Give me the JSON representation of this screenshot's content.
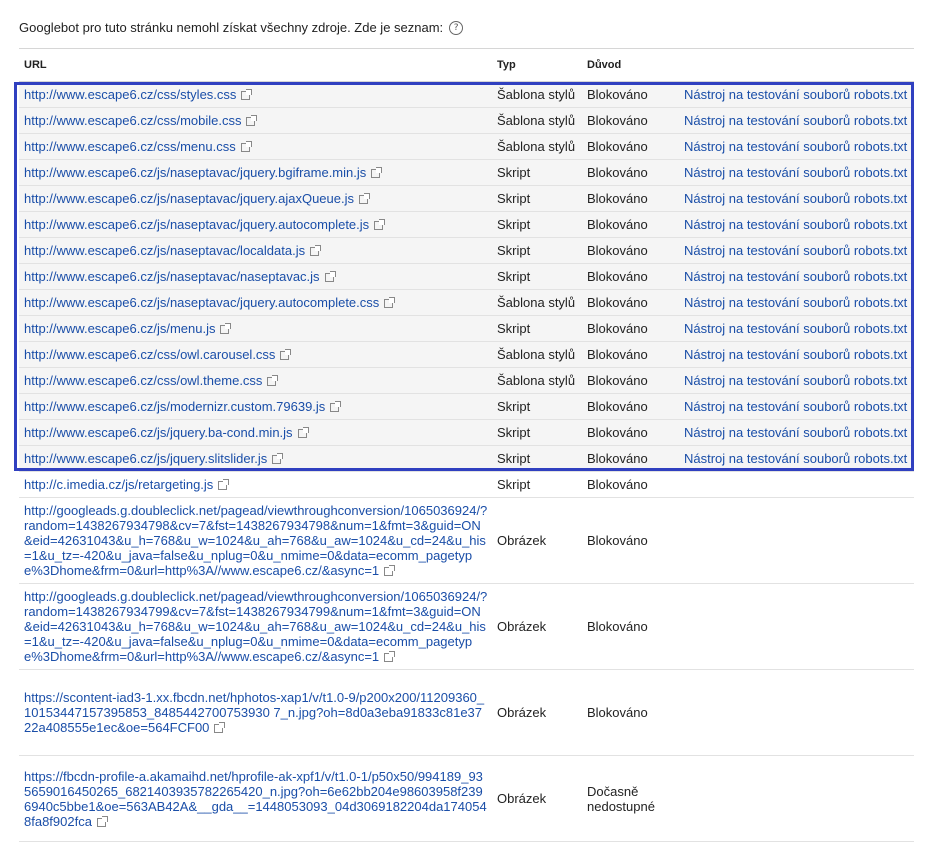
{
  "intro_text": "Googlebot pro tuto stránku nemohl získat všechny zdroje. Zde je seznam:",
  "help_icon": "question-circle-icon",
  "columns": {
    "url": "URL",
    "type": "Typ",
    "reason": "Důvod"
  },
  "highlight_color": "#3040c0",
  "link_color": "#1a4ea8",
  "rows": [
    {
      "url": "http://www.escape6.cz/css/styles.css",
      "type": "Šablona stylů",
      "reason": "Blokováno",
      "tool": "Nástroj na testování souborů robots.txt"
    },
    {
      "url": "http://www.escape6.cz/css/mobile.css",
      "type": "Šablona stylů",
      "reason": "Blokováno",
      "tool": "Nástroj na testování souborů robots.txt"
    },
    {
      "url": "http://www.escape6.cz/css/menu.css",
      "type": "Šablona stylů",
      "reason": "Blokováno",
      "tool": "Nástroj na testování souborů robots.txt"
    },
    {
      "url": "http://www.escape6.cz/js/naseptavac/jquery.bgiframe.min.js",
      "type": "Skript",
      "reason": "Blokováno",
      "tool": "Nástroj na testování souborů robots.txt"
    },
    {
      "url": "http://www.escape6.cz/js/naseptavac/jquery.ajaxQueue.js",
      "type": "Skript",
      "reason": "Blokováno",
      "tool": "Nástroj na testování souborů robots.txt"
    },
    {
      "url": "http://www.escape6.cz/js/naseptavac/jquery.autocomplete.js",
      "type": "Skript",
      "reason": "Blokováno",
      "tool": "Nástroj na testování souborů robots.txt"
    },
    {
      "url": "http://www.escape6.cz/js/naseptavac/localdata.js",
      "type": "Skript",
      "reason": "Blokováno",
      "tool": "Nástroj na testování souborů robots.txt"
    },
    {
      "url": "http://www.escape6.cz/js/naseptavac/naseptavac.js",
      "type": "Skript",
      "reason": "Blokováno",
      "tool": "Nástroj na testování souborů robots.txt"
    },
    {
      "url": "http://www.escape6.cz/js/naseptavac/jquery.autocomplete.css",
      "type": "Šablona stylů",
      "reason": "Blokováno",
      "tool": "Nástroj na testování souborů robots.txt"
    },
    {
      "url": "http://www.escape6.cz/js/menu.js",
      "type": "Skript",
      "reason": "Blokováno",
      "tool": "Nástroj na testování souborů robots.txt"
    },
    {
      "url": "http://www.escape6.cz/css/owl.carousel.css",
      "type": "Šablona stylů",
      "reason": "Blokováno",
      "tool": "Nástroj na testování souborů robots.txt"
    },
    {
      "url": "http://www.escape6.cz/css/owl.theme.css",
      "type": "Šablona stylů",
      "reason": "Blokováno",
      "tool": "Nástroj na testování souborů robots.txt"
    },
    {
      "url": "http://www.escape6.cz/js/modernizr.custom.79639.js",
      "type": "Skript",
      "reason": "Blokováno",
      "tool": "Nástroj na testování souborů robots.txt"
    },
    {
      "url": "http://www.escape6.cz/js/jquery.ba-cond.min.js",
      "type": "Skript",
      "reason": "Blokováno",
      "tool": "Nástroj na testování souborů robots.txt"
    },
    {
      "url": "http://www.escape6.cz/js/jquery.slitslider.js",
      "type": "Skript",
      "reason": "Blokováno",
      "tool": "Nástroj na testování souborů robots.txt"
    },
    {
      "url": "http://c.imedia.cz/js/retargeting.js",
      "type": "Skript",
      "reason": "Blokováno",
      "tool": ""
    },
    {
      "url": "http://googleads.g.doubleclick.net/pagead/viewthroughconversion/1065036924/?random=1438267934798&cv=7&fst=1438267934798&num=1&fmt=3&guid=ON&eid=42631043&u_h=768&u_w=1024&u_ah=768&u_aw=1024&u_cd=24&u_his=1&u_tz=-420&u_java=false&u_nplug=0&u_nmime=0&data=ecomm_pagetype%3Dhome&frm=0&url=http%3A//www.escape6.cz/&async=1",
      "type": "Obrázek",
      "reason": "Blokováno",
      "tool": ""
    },
    {
      "url": "http://googleads.g.doubleclick.net/pagead/viewthroughconversion/1065036924/?random=1438267934799&cv=7&fst=1438267934799&num=1&fmt=3&guid=ON&eid=42631043&u_h=768&u_w=1024&u_ah=768&u_aw=1024&u_cd=24&u_his=1&u_tz=-420&u_java=false&u_nplug=0&u_nmime=0&data=ecomm_pagetype%3Dhome&frm=0&url=http%3A//www.escape6.cz/&async=1",
      "type": "Obrázek",
      "reason": "Blokováno",
      "tool": ""
    },
    {
      "url": "https://scontent-iad3-1.xx.fbcdn.net/hphotos-xap1/v/t1.0-9/p200x200/11209360_10153447157395853_8485442700753930 7_n.jpg?oh=8d0a3eba91833c81e3722a408555e1ec&oe=564FCF00",
      "type": "Obrázek",
      "reason": "Blokováno",
      "tool": ""
    },
    {
      "url": "https://fbcdn-profile-a.akamaihd.net/hprofile-ak-xpf1/v/t1.0-1/p50x50/994189_935659016450265_6821403935782265420_n.jpg?oh=6e62bb204e98603958f2396940c5bbe1&oe=563AB42A&__gda__=1448053093_04d3069182204da1740548fa8f902fca",
      "type": "Obrázek",
      "reason": "Dočasně nedostupné",
      "tool": ""
    }
  ]
}
